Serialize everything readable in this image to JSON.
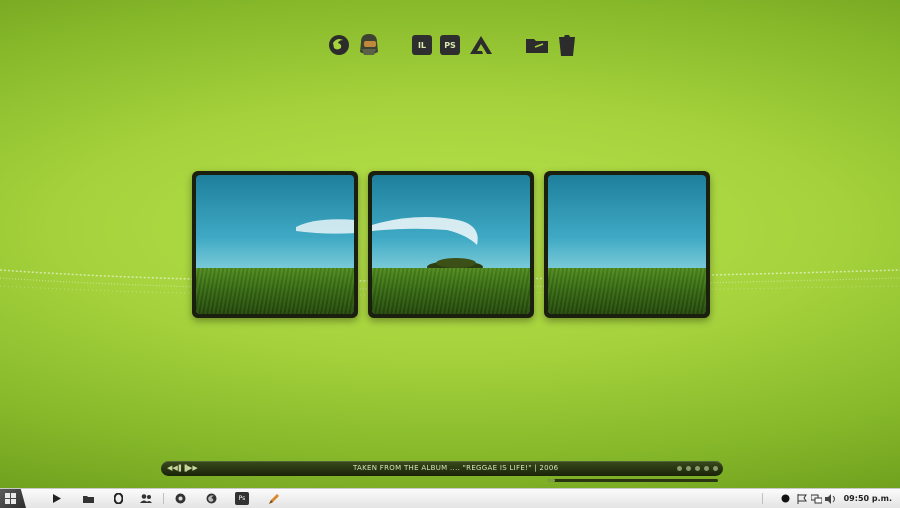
{
  "dock": {
    "group1": [
      "firefox-icon",
      "master-chief-icon"
    ],
    "group2": [
      "illustrator-icon",
      "photoshop-icon",
      "autodesk-icon"
    ],
    "group3": [
      "folder-icon",
      "trash-icon"
    ],
    "illustrator_label": "IL",
    "photoshop_label": "PS"
  },
  "player": {
    "track_text": "TAKEN FROM THE ALBUM .... \"REGGAE IS LIFE!\"  |  2006",
    "progress": 0.04
  },
  "taskbar": {
    "clock": "09:50 p.m.",
    "photoshop_label": "Ps"
  },
  "colors": {
    "accent": "#a6d33d",
    "frame": "#1b1f0e"
  }
}
